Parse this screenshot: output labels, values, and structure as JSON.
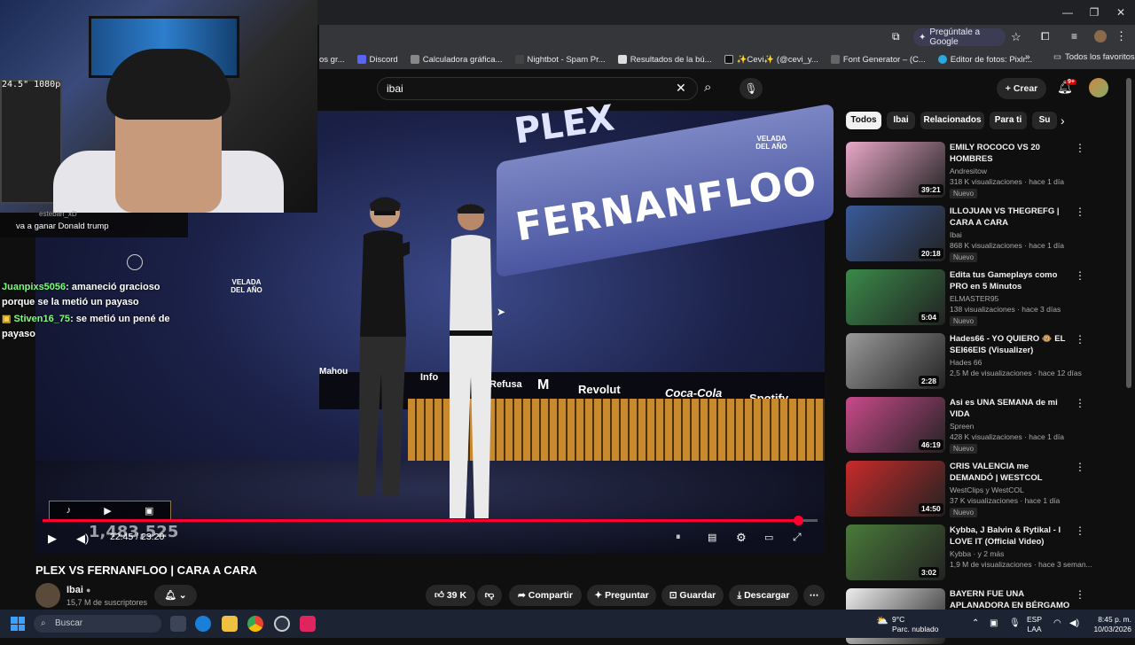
{
  "browser": {
    "ask_google": "Pregúntale a Google",
    "bookmarks": [
      "os gr...",
      "Discord",
      "Calculadora gráfica...",
      "Nightbot - Spam Pr...",
      "Resultados de la bú...",
      "✨Cevi✨ (@cevi_y...",
      "Font Generator – (C...",
      "Editor de fotos: Pixlr..."
    ],
    "all_favorites": "Todos los favoritos"
  },
  "youtube": {
    "search_value": "ibai",
    "create_label": "Crear",
    "notif_badge": "9+"
  },
  "overlay": {
    "top_user": "esteban_xD",
    "top_msg": "va a ganar Donald trump",
    "chat": [
      {
        "user": "Juanpixs5056",
        "text": ": amaneció gracioso porque se la metió un payaso"
      },
      {
        "user": "Stiven16_75",
        "text": ": se metió un pené de payaso"
      }
    ],
    "viewer_counter": "1,483,525",
    "stat": "24.5\" 1080p"
  },
  "video": {
    "stage_text_main": "FERNANFLOO",
    "stage_text_top": "PLEX",
    "event_logo": "VELADA DEL AÑO",
    "sponsors": [
      "Mahou",
      "Info",
      "Refusa",
      "Revolut",
      "Coca-Cola",
      "Spotify"
    ],
    "time_current": "22:45",
    "time_total": "23:20",
    "progress": 0.975
  },
  "watch": {
    "title": "PLEX VS FERNANFLOO | CARA A CARA",
    "channel": "Ibai",
    "subscribers": "15,7 M de suscriptores",
    "likes": "39 K",
    "share": "Compartir",
    "ask": "Preguntar",
    "save": "Guardar",
    "download": "Descargar"
  },
  "sidebar": {
    "chips": [
      "Todos",
      "Ibai",
      "Relacionados",
      "Para ti",
      "Su"
    ],
    "items": [
      {
        "title": "EMILY ROCOCO VS 20 HOMBRES",
        "channel": "Andresitow",
        "meta": "318 K visualizaciones · hace 1 día",
        "duration": "39:21",
        "nuevo": "Nuevo",
        "color": "#e9a8c8"
      },
      {
        "title": "ILLOJUAN VS THEGREFG | CARA A CARA",
        "channel": "Ibai",
        "meta": "868 K visualizaciones · hace 1 día",
        "duration": "20:18",
        "nuevo": "Nuevo",
        "color": "#3a5a9a"
      },
      {
        "title": "Edita tus Gameplays como PRO en 5 Minutos",
        "channel": "ELMASTER95",
        "meta": "138 visualizaciones · hace 3 días",
        "duration": "5:04",
        "nuevo": "Nuevo",
        "color": "#3a8a4a"
      },
      {
        "title": "Hades66 - YO QUIERO 🐵 EL SEI66EIS (Visualizer)",
        "channel": "Hades 66",
        "meta": "2,5 M de visualizaciones · hace 12 días",
        "duration": "2:28",
        "nuevo": "",
        "color": "#9a9a9a"
      },
      {
        "title": "Asi es UNA SEMANA de mi VIDA",
        "channel": "Spreen",
        "meta": "428 K visualizaciones · hace 1 día",
        "duration": "46:19",
        "nuevo": "Nuevo",
        "color": "#c84a8a"
      },
      {
        "title": "CRIS VALENCIA me DEMANDÓ | WESTCOL",
        "channel": "WestClips y WestCOL",
        "meta": "37 K visualizaciones · hace 1 día",
        "duration": "14:50",
        "nuevo": "Nuevo",
        "color": "#c82a2a"
      },
      {
        "title": "Kybba, J Balvin & Rytikal - I LOVE IT (Official Video)",
        "channel": "Kybba · y 2 más",
        "meta": "1,9 M de visualizaciones · hace 3 seman...",
        "duration": "3:02",
        "nuevo": "",
        "color": "#4a7a3a"
      },
      {
        "title": "BAYERN FUE UNA APLANADORA EN BÉRGAMO ...",
        "channel": "",
        "meta": "",
        "duration": "",
        "nuevo": "",
        "color": "#eeeeee"
      }
    ]
  },
  "taskbar": {
    "search": "Buscar",
    "weather_temp": "9°C",
    "weather_desc": "Parc. nublado",
    "lang": "ESP",
    "lang2": "LAA",
    "time": "8:45 p. m.",
    "date": "10/03/2026"
  }
}
